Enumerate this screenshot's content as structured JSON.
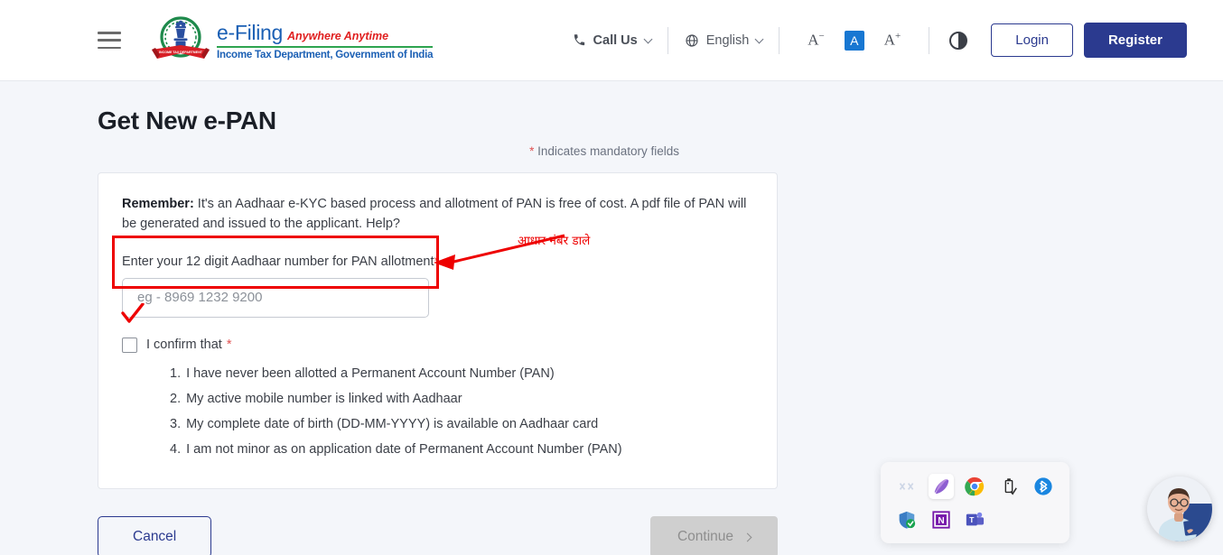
{
  "header": {
    "menu_icon": "hamburger-menu-icon",
    "emblem_icon": "income-tax-department-emblem",
    "brand_primary": "e-Filing",
    "brand_tagline": "Anywhere Anytime",
    "brand_department": "Income Tax Department, Government of India",
    "call_us_label": "Call Us",
    "call_us_icon": "phone-icon",
    "language_label": "English",
    "language_icon": "globe-icon",
    "font_decrease_label": "A",
    "font_decrease_sup": "−",
    "font_normal_label": "A",
    "font_increase_label": "A",
    "font_increase_sup": "+",
    "contrast_icon": "contrast-icon",
    "login_label": "Login",
    "register_label": "Register",
    "accent_blue": "#2b3a8f",
    "accent_selected": "#1877d2"
  },
  "main": {
    "page_title": "Get New e-PAN",
    "mandatory_note_star": "*",
    "mandatory_note": "Indicates mandatory fields",
    "remember_label": "Remember:",
    "remember_text": " It's an Aadhaar e-KYC based process and allotment of PAN is free of cost. A pdf file of PAN will be generated and issued to the applicant. Help?",
    "field_label": "Enter your 12 digit Aadhaar number for PAN allotment",
    "field_label_star": "*",
    "aadhaar_placeholder": "eg - 8969 1232 9200",
    "aadhaar_value": "",
    "confirm_label": "I confirm that",
    "confirm_star": "*",
    "confirm_checked": false,
    "conditions": [
      {
        "num": "1.",
        "text": "I have never been allotted a Permanent Account Number (PAN)"
      },
      {
        "num": "2.",
        "text": "My active mobile number is linked with Aadhaar"
      },
      {
        "num": "3.",
        "text": "My complete date of birth (DD-MM-YYYY) is available on Aadhaar card"
      },
      {
        "num": "4.",
        "text": "I am not minor as on application date of Permanent Account Number (PAN)"
      }
    ],
    "cancel_label": "Cancel",
    "continue_label": "Continue",
    "continue_chevron": ">",
    "continue_disabled": true
  },
  "annotations": {
    "color": "#ee0000",
    "hindi_note": "आधार नंबर  डाले",
    "arrow_name": "red-arrow-annotation",
    "box_name": "red-highlight-box-annotation",
    "check_name": "red-checkmark-annotation"
  },
  "tray": {
    "icons": [
      {
        "name": "hidden-app-icon",
        "label": ""
      },
      {
        "name": "snip-quill-icon",
        "label": ""
      },
      {
        "name": "google-chrome-icon",
        "label": ""
      },
      {
        "name": "safely-remove-usb-icon",
        "label": ""
      },
      {
        "name": "bluetooth-icon",
        "label": ""
      },
      {
        "name": "windows-security-shield-icon",
        "label": ""
      },
      {
        "name": "onenote-icon",
        "label": ""
      },
      {
        "name": "microsoft-teams-icon",
        "label": ""
      }
    ]
  },
  "chat": {
    "avatar_name": "support-chat-avatar"
  }
}
